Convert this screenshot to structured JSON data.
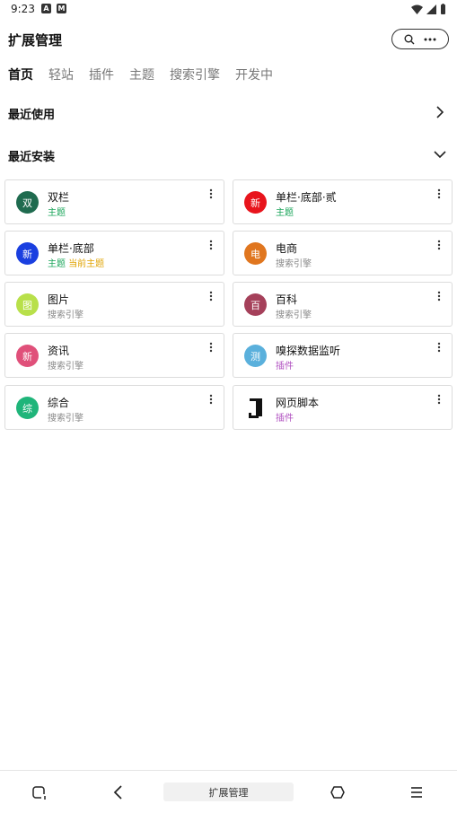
{
  "status": {
    "time": "9:23",
    "left_icons": [
      "A",
      "M"
    ]
  },
  "header": {
    "title": "扩展管理"
  },
  "tabs": [
    {
      "label": "首页",
      "active": true
    },
    {
      "label": "轻站",
      "active": false
    },
    {
      "label": "插件",
      "active": false
    },
    {
      "label": "主题",
      "active": false
    },
    {
      "label": "搜索引擎",
      "active": false
    },
    {
      "label": "开发中",
      "active": false
    }
  ],
  "sections": {
    "recent_used": "最近使用",
    "recent_installed": "最近安装"
  },
  "extensions": [
    {
      "name": "双栏",
      "avatar": "双",
      "avatar_color": "#1f6b4f",
      "tags": [
        {
          "text": "主题",
          "color": "#1aa55a"
        }
      ]
    },
    {
      "name": "单栏·底部·贰",
      "avatar": "新",
      "avatar_color": "#e8141c",
      "tags": [
        {
          "text": "主题",
          "color": "#1aa55a"
        }
      ]
    },
    {
      "name": "单栏·底部",
      "avatar": "新",
      "avatar_color": "#1a3fe0",
      "tags": [
        {
          "text": "主题",
          "color": "#1aa55a"
        },
        {
          "text": "当前主题",
          "color": "#e0a300"
        }
      ]
    },
    {
      "name": "电商",
      "avatar": "电",
      "avatar_color": "#e0761f",
      "tags": [
        {
          "text": "搜索引擎",
          "color": "#888888"
        }
      ]
    },
    {
      "name": "图片",
      "avatar": "图",
      "avatar_color": "#b8e04a",
      "tags": [
        {
          "text": "搜索引擎",
          "color": "#888888"
        }
      ]
    },
    {
      "name": "百科",
      "avatar": "百",
      "avatar_color": "#a5405a",
      "tags": [
        {
          "text": "搜索引擎",
          "color": "#888888"
        }
      ]
    },
    {
      "name": "资讯",
      "avatar": "新",
      "avatar_color": "#e0507a",
      "tags": [
        {
          "text": "搜索引擎",
          "color": "#888888"
        }
      ]
    },
    {
      "name": "嗅探数据监听",
      "avatar": "测",
      "avatar_color": "#5ab0dc",
      "tags": [
        {
          "text": "插件",
          "color": "#b050c0"
        }
      ]
    },
    {
      "name": "综合",
      "avatar": "综",
      "avatar_color": "#1fb57a",
      "tags": [
        {
          "text": "搜索引擎",
          "color": "#888888"
        }
      ]
    },
    {
      "name": "网页脚本",
      "avatar": "",
      "avatar_color": "#ffffff",
      "tags": [
        {
          "text": "插件",
          "color": "#b050c0"
        }
      ]
    }
  ],
  "bottom_nav": {
    "center_label": "扩展管理"
  }
}
